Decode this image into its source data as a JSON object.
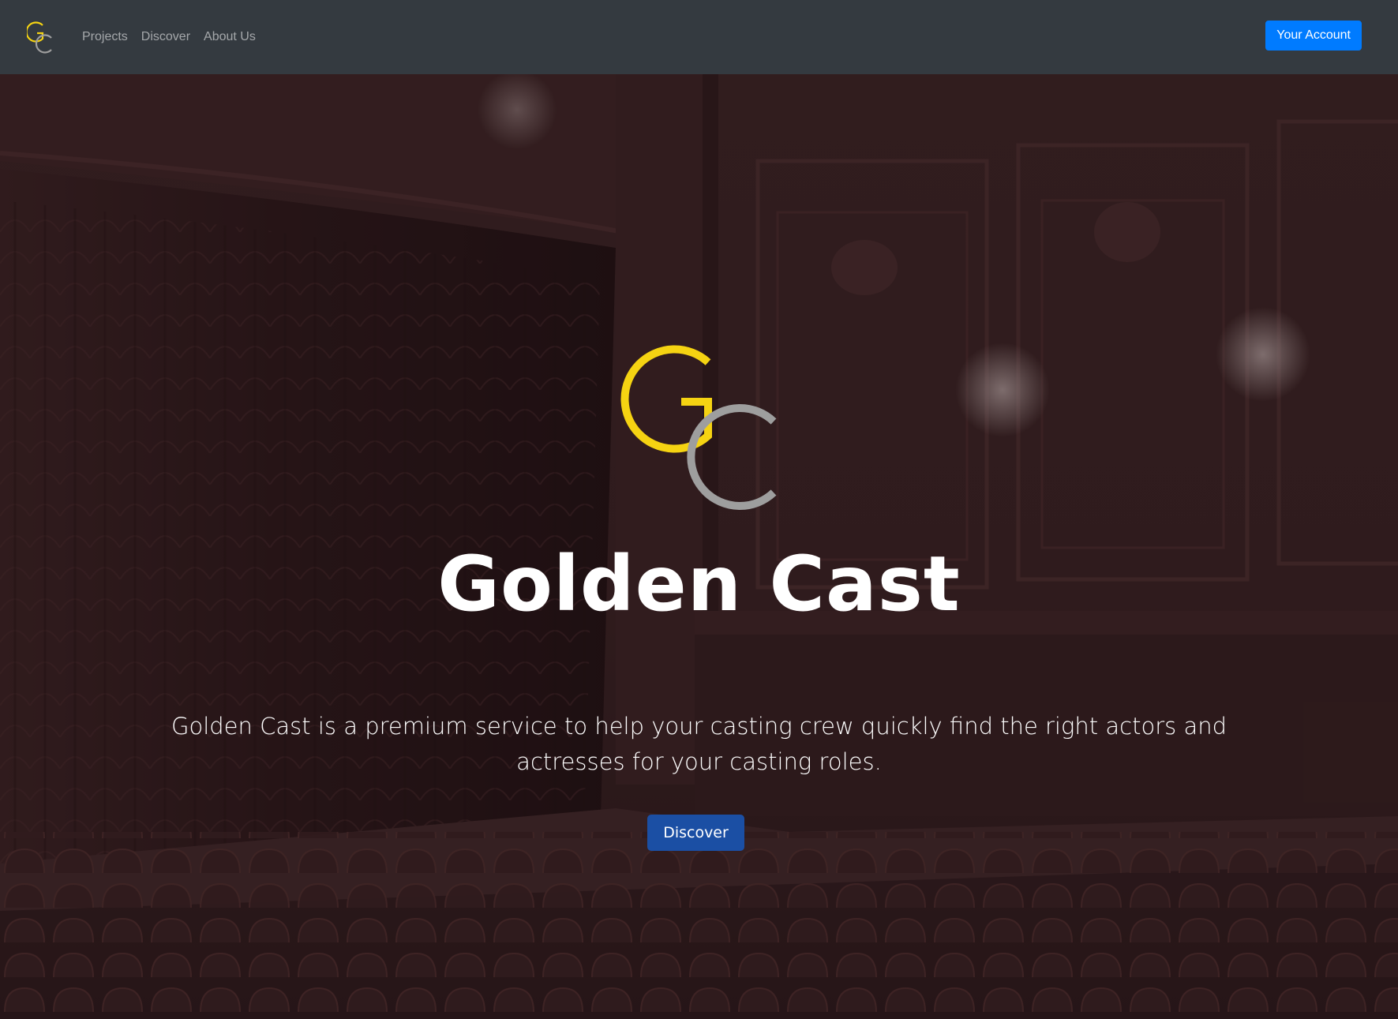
{
  "navbar": {
    "brand_logo": "golden-cast-logo",
    "links": [
      {
        "label": "Projects"
      },
      {
        "label": "Discover"
      },
      {
        "label": "About Us"
      }
    ],
    "account_button": "Your Account"
  },
  "hero": {
    "title": "Golden Cast",
    "description": "Golden Cast is a premium service to help your casting crew quickly find the right actors and actresses for your casting roles.",
    "cta_button": "Discover",
    "background": "theater-stage-photo"
  },
  "colors": {
    "navbar_bg": "#343a40",
    "account_button_bg": "#007bff",
    "cta_button_bg": "#1b4fa4",
    "logo_gold": "#f5d312",
    "logo_gray": "#9e9e9e"
  }
}
